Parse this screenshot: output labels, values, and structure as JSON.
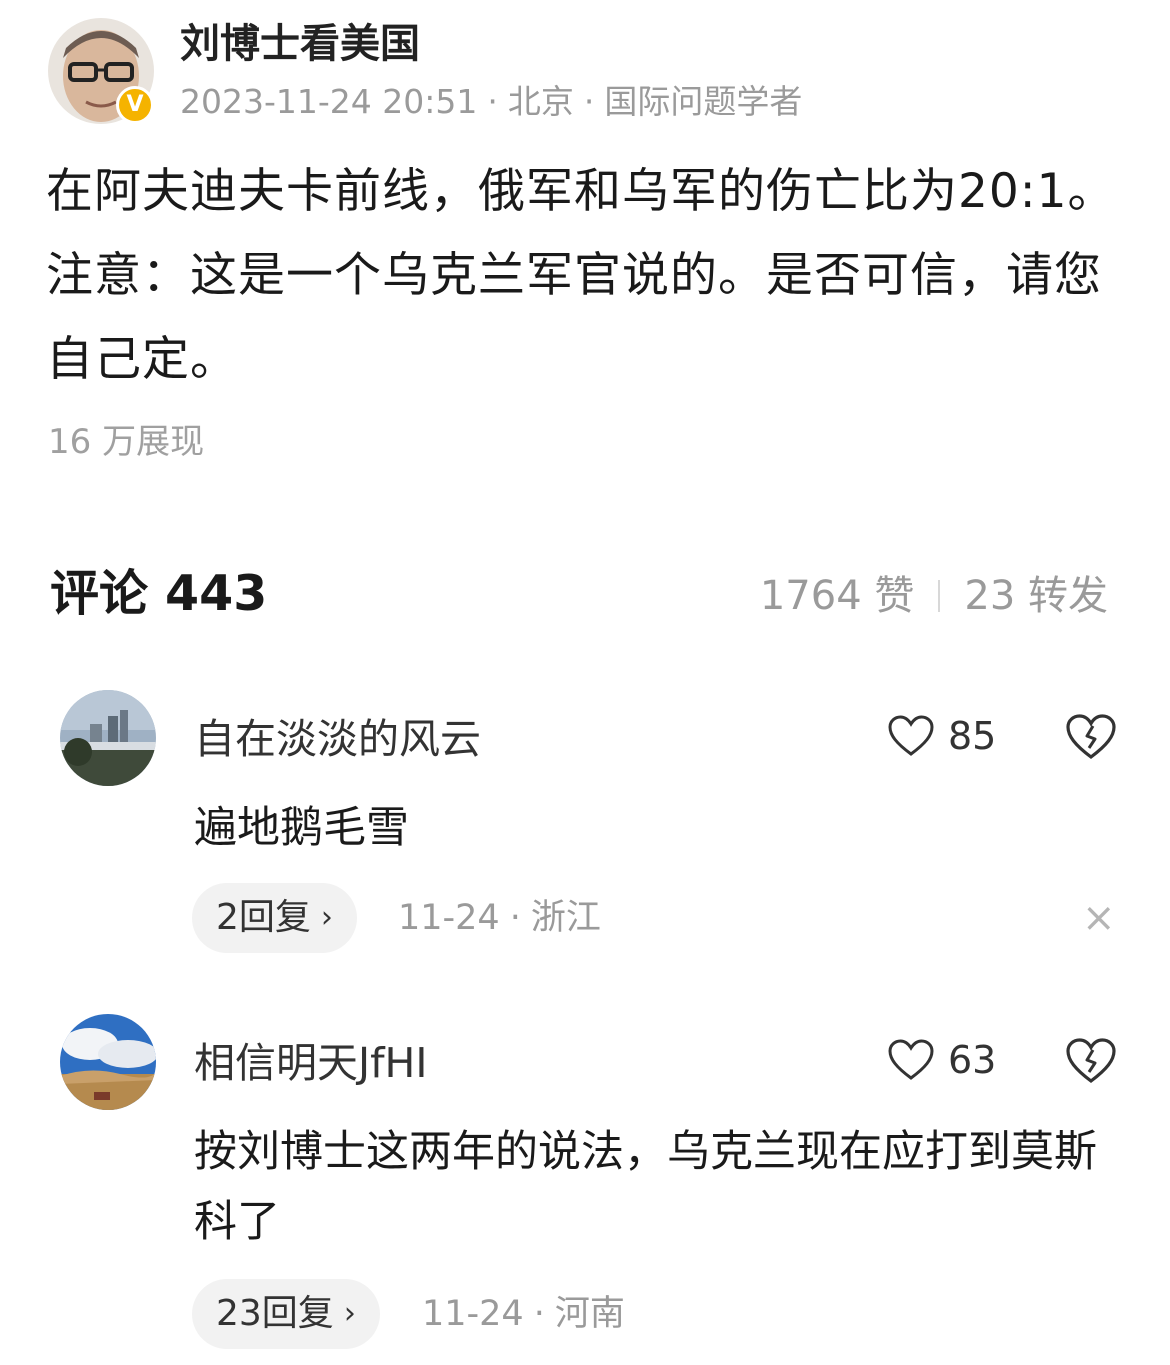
{
  "post": {
    "author": "刘博士看美国",
    "date": "2023-11-24 20:51",
    "location": "北京",
    "author_title": "国际问题学者",
    "verified_badge": "V",
    "body": "在阿夫迪夫卡前线，俄军和乌军的伤亡比为20:1。注意：这是一个乌克兰军官说的。是否可信，请您自己定。",
    "views": "16 万展现"
  },
  "stats": {
    "comments_label": "评论 443",
    "likes": "1764 赞",
    "reposts": "23 转发"
  },
  "comments": [
    {
      "user": "自在淡淡的风云",
      "likes": "85",
      "text": "遍地鹅毛雪",
      "replies": "2回复",
      "date": "11-24",
      "location": "浙江",
      "close": "×"
    },
    {
      "user": "相信明天JfHI",
      "likes": "63",
      "text": "按刘博士这两年的说法，乌克兰现在应打到莫斯科了",
      "replies": "23回复",
      "date": "11-24",
      "location": "河南"
    }
  ],
  "icons": {
    "like": "heart-outline-icon",
    "dislike": "broken-heart-icon",
    "reply_chevron": "chevron-right-icon",
    "close": "close-icon",
    "verified": "verified-badge-icon"
  },
  "colors": {
    "verified_badge": "#f5b300",
    "meta_text": "#9a9a9a",
    "reply_pill_bg": "#f2f2f2"
  },
  "meta_separator": "·",
  "chevron": "›"
}
